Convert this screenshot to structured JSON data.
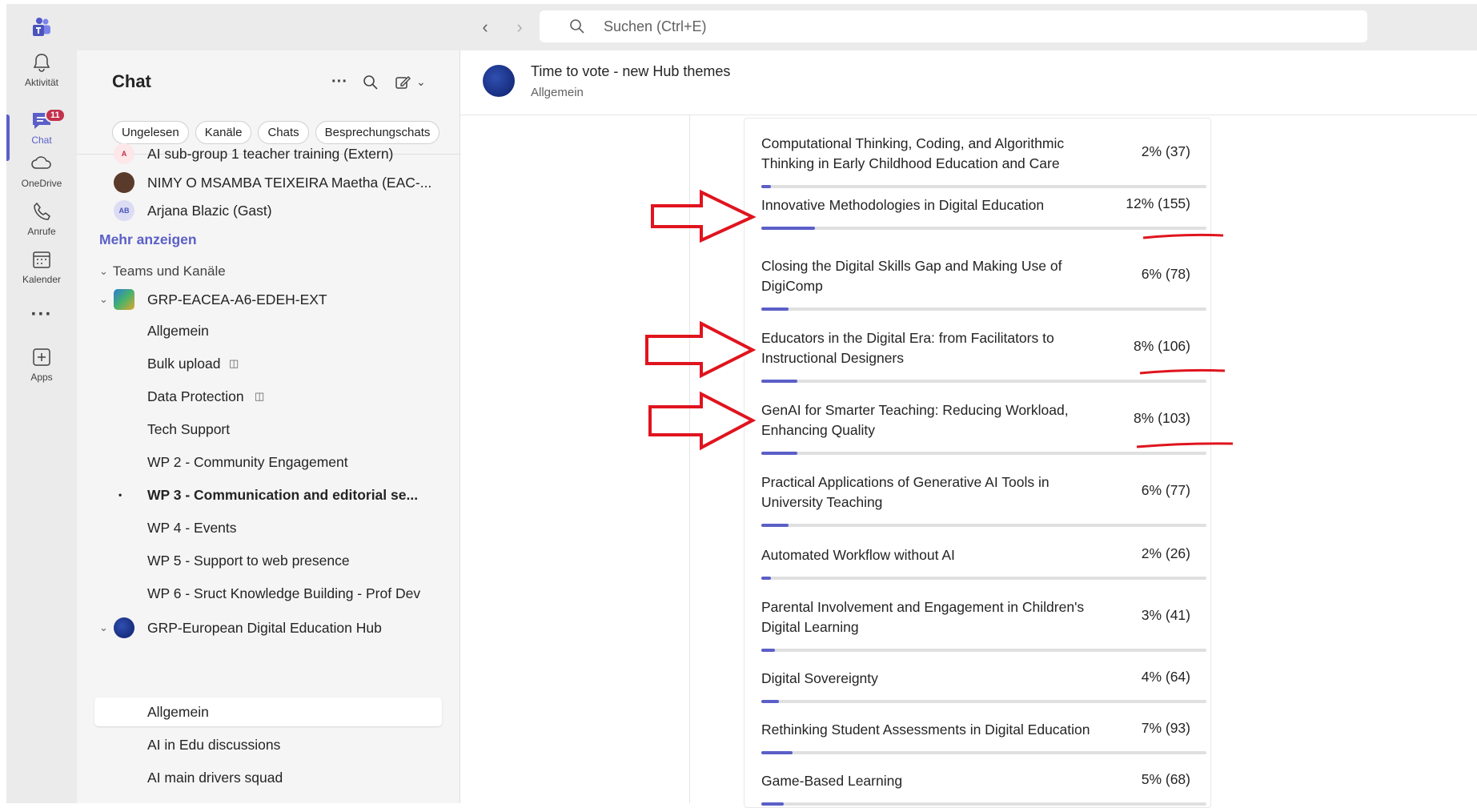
{
  "search": {
    "placeholder": "Suchen (Ctrl+E)"
  },
  "rail": [
    {
      "label": "Aktivität",
      "icon": "bell-icon"
    },
    {
      "label": "Chat",
      "icon": "chat-icon",
      "badge": "11"
    },
    {
      "label": "OneDrive",
      "icon": "cloud-icon"
    },
    {
      "label": "Anrufe",
      "icon": "phone-icon"
    },
    {
      "label": "Kalender",
      "icon": "calendar-icon"
    },
    {
      "label": "Apps",
      "icon": "add-app-icon"
    }
  ],
  "panel": {
    "title": "Chat",
    "filters": [
      "Ungelesen",
      "Kanäle",
      "Chats",
      "Besprechungschats"
    ],
    "chats": [
      {
        "name": "AI sub-group 1 teacher training (Extern)"
      },
      {
        "name": "NIMY O MSAMBA TEIXEIRA Maetha (EAC-..."
      },
      {
        "name": "Arjana Blazic (Gast)",
        "initials": "AB"
      }
    ],
    "more": "Mehr anzeigen",
    "section": "Teams und Kanäle",
    "team1": "GRP-EACEA-A6-EDEH-EXT",
    "team1_channels": [
      "Allgemein",
      "Bulk upload",
      "Data Protection",
      "Tech Support",
      "WP 2 - Community Engagement",
      "WP 3 - Communication and editorial se...",
      "WP 4 - Events",
      "WP 5 - Support to web presence",
      "WP 6 - Sruct Knowledge Building - Prof Dev"
    ],
    "team2": "GRP-European Digital Education Hub",
    "team2_channels": [
      "Allgemein",
      "AI in Edu discussions",
      "AI main drivers squad"
    ]
  },
  "header": {
    "title": "Time to vote - new Hub themes",
    "channel": "Allgemein"
  },
  "poll": [
    {
      "label": "Computational Thinking, Coding, and Algorithmic Thinking in Early Childhood Education and Care",
      "value": "2% (37)",
      "pct": 2
    },
    {
      "label": "Innovative Methodologies in Digital Education",
      "value": "12% (155)",
      "pct": 12
    },
    {
      "label": "Closing the Digital Skills Gap and Making Use of DigiComp",
      "value": "6% (78)",
      "pct": 6
    },
    {
      "label": "Educators in the Digital Era: from Facilitators to Instructional Designers",
      "value": "8% (106)",
      "pct": 8
    },
    {
      "label": "GenAI for Smarter Teaching: Reducing Workload, Enhancing Quality",
      "value": "8% (103)",
      "pct": 8
    },
    {
      "label": "Practical Applications of Generative AI Tools in University Teaching",
      "value": "6% (77)",
      "pct": 6
    },
    {
      "label": "Automated Workflow without AI",
      "value": "2% (26)",
      "pct": 2
    },
    {
      "label": "Parental Involvement and Engagement in Children's Digital Learning",
      "value": "3% (41)",
      "pct": 3
    },
    {
      "label": "Digital Sovereignty",
      "value": "4% (64)",
      "pct": 4
    },
    {
      "label": "Rethinking Student Assessments in Digital Education",
      "value": "7% (93)",
      "pct": 7
    },
    {
      "label": "Game-Based Learning",
      "value": "5% (68)",
      "pct": 5
    }
  ],
  "colors": {
    "accent": "#5b5fc7",
    "annotation": "#e0141e",
    "badge": "#c4314b"
  }
}
